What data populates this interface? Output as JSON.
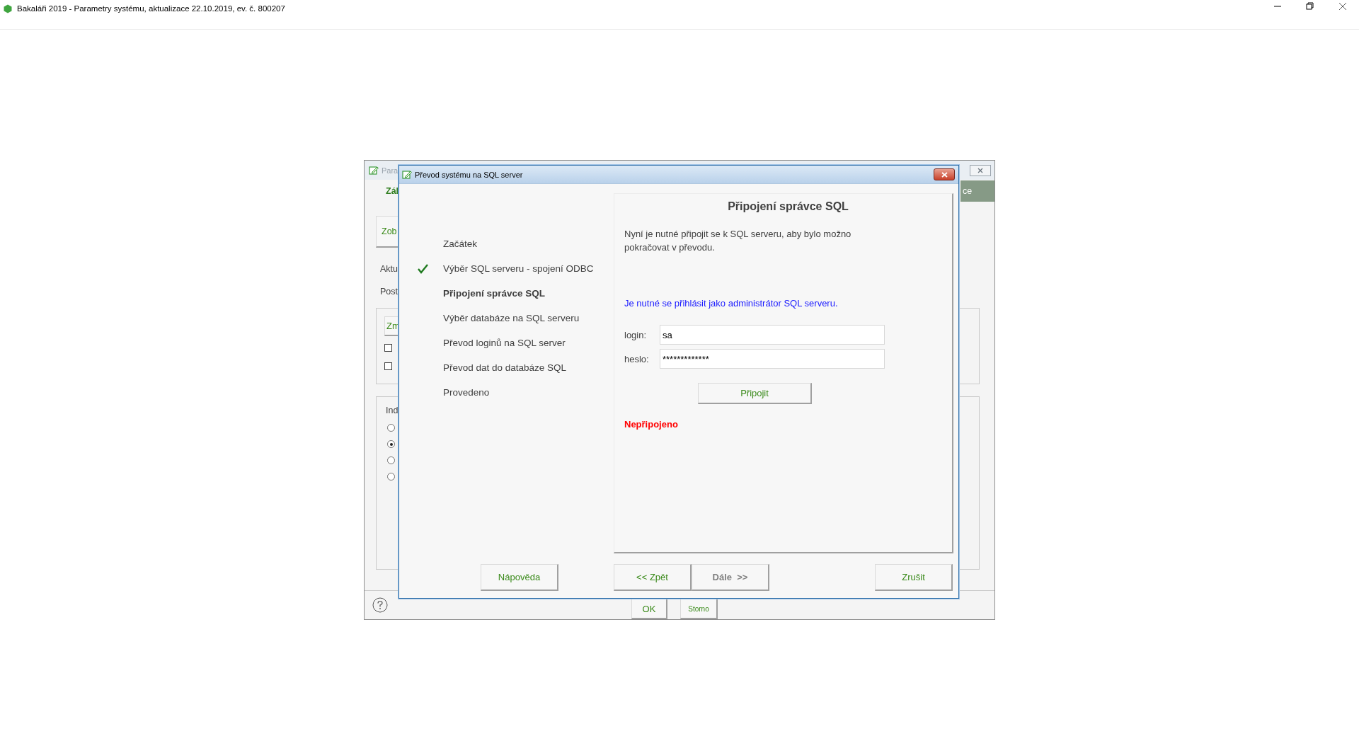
{
  "app_window": {
    "title": "Bakaláři 2019 - Parametry systému, aktualizace 22.10.2019, ev. č. 800207"
  },
  "background_window": {
    "title": "Para",
    "heading": "Zál",
    "side_tab": "ce",
    "tab": "Zob",
    "labels": [
      "Aktu",
      "Post"
    ],
    "group_button": "Zm",
    "checkboxes": [
      {
        "checked": false
      },
      {
        "checked": false
      }
    ],
    "group_title": "Ind",
    "radios": [
      {
        "selected": false
      },
      {
        "selected": true
      },
      {
        "selected": false
      },
      {
        "selected": false
      }
    ],
    "buttons": [
      "OK",
      "Storno"
    ]
  },
  "dialog": {
    "title": "Převod systému na SQL server",
    "steps": [
      {
        "label": "Začátek",
        "done": false,
        "current": false
      },
      {
        "label": "Výběr SQL serveru - spojení ODBC",
        "done": true,
        "current": false
      },
      {
        "label": "Připojení správce SQL",
        "done": false,
        "current": true
      },
      {
        "label": "Výběr databáze na SQL serveru",
        "done": false,
        "current": false
      },
      {
        "label": "Převod loginů na SQL server",
        "done": false,
        "current": false
      },
      {
        "label": "Převod dat do databáze SQL",
        "done": false,
        "current": false
      },
      {
        "label": "Provedeno",
        "done": false,
        "current": false
      }
    ],
    "heading": "Připojení správce SQL",
    "intro": "Nyní je nutné připojit se k SQL serveru, aby bylo možno pokračovat v převodu.",
    "notice": "Je nutné se přihlásit jako administrátor SQL serveru.",
    "fields": [
      {
        "label": "login:",
        "value": "sa"
      },
      {
        "label": "heslo:",
        "value": "*************"
      }
    ],
    "connect_button": "Připojit",
    "status": "Nepřipojeno",
    "buttons": [
      {
        "label": "Nápověda",
        "disabled": false
      },
      {
        "label": "<< Zpět",
        "disabled": false
      },
      {
        "label": "Dále  >>",
        "disabled": true
      },
      {
        "label": "Zrušit",
        "disabled": false
      }
    ]
  }
}
